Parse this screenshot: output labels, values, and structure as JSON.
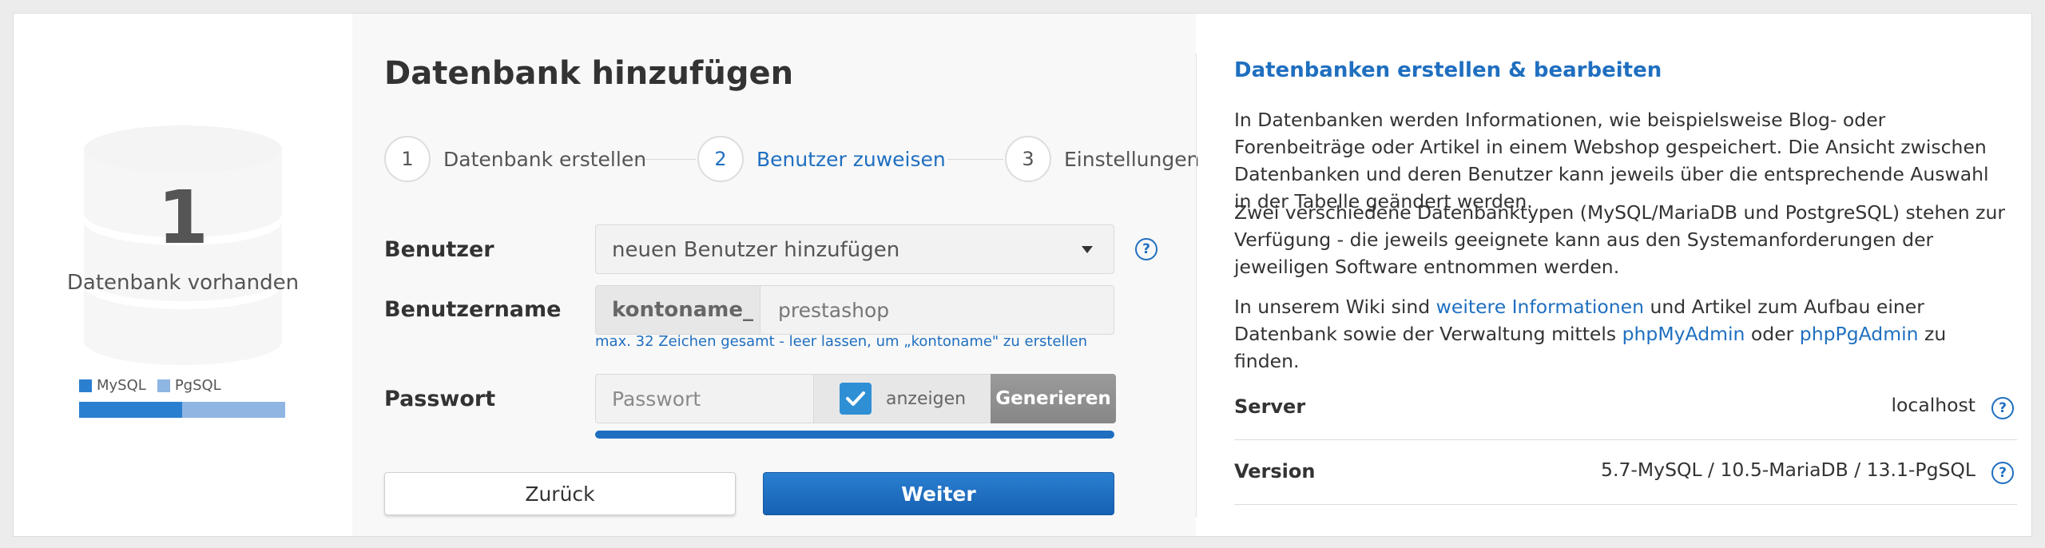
{
  "stats": {
    "count": "1",
    "count_label": "Datenbank vorhanden",
    "legend": [
      {
        "label": "MySQL",
        "color": "#2a7fd0"
      },
      {
        "label": "PgSQL",
        "color": "#8fb6e3"
      }
    ],
    "type_fractions": {
      "mysql": 0.5,
      "pgsql": 0.5
    }
  },
  "form": {
    "title": "Datenbank hinzufügen",
    "steps": [
      {
        "number": "1",
        "label": "Datenbank erstellen",
        "active": false
      },
      {
        "number": "2",
        "label": "Benutzer zuweisen",
        "active": true
      },
      {
        "number": "3",
        "label": "Einstellungen",
        "active": false
      }
    ],
    "user_label": "Benutzer",
    "user_select_value": "neuen Benutzer hinzufügen",
    "username_label": "Benutzername",
    "username_prefix": "kontoname_",
    "username_value": "prestashop",
    "username_hint": "max. 32 Zeichen gesamt - leer lassen, um „kontoname\" zu erstellen",
    "password_label": "Passwort",
    "password_placeholder": "Passwort",
    "show_label": "anzeigen",
    "show_checked": true,
    "generate_label": "Generieren",
    "back_label": "Zurück",
    "next_label": "Weiter",
    "help_glyph": "?"
  },
  "info": {
    "title": "Datenbanken erstellen & bearbeiten",
    "para1": "In Datenbanken werden Informationen, wie beispielsweise Blog- oder Forenbeiträge oder Artikel in einem Webshop gespeichert. Die Ansicht zwischen Datenbanken und deren Benutzer kann jeweils über die entsprechende Auswahl in der Tabelle geändert werden.",
    "para2": "Zwei verschiedene Datenbanktypen (MySQL/MariaDB und PostgreSQL) stehen zur Verfügung - die jeweils geeignete kann aus den Systemanforderungen der jeweiligen Software entnommen werden.",
    "para3_prefix": "In unserem Wiki sind ",
    "para3_link1": "weitere Informationen",
    "para3_mid1": " und Artikel zum Aufbau einer Datenbank sowie der Verwaltung mittels ",
    "para3_link2": "phpMyAdmin",
    "para3_mid2": " oder ",
    "para3_link3": "phpPgAdmin",
    "para3_suffix": " zu finden.",
    "server_label": "Server",
    "server_value": "localhost",
    "version_label": "Version",
    "version_value": "5.7-MySQL / 10.5-MariaDB / 13.1-PgSQL"
  },
  "colors": {
    "accent": "#1f6fc0",
    "button_primary": "#1b6ac0",
    "checkbox": "#2f8fd5"
  }
}
